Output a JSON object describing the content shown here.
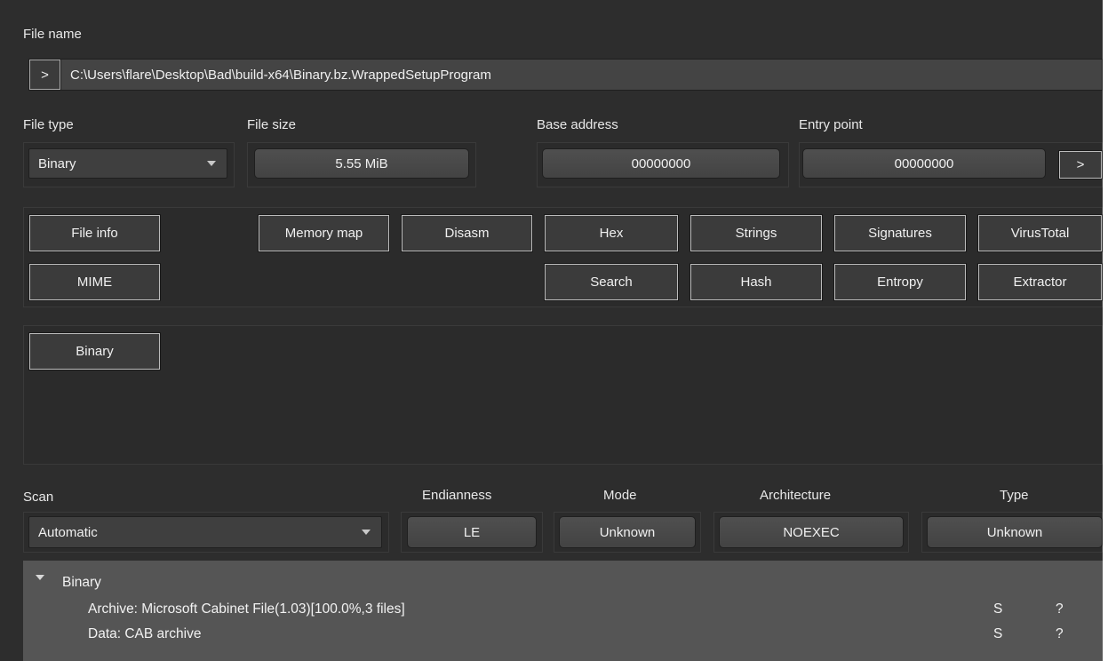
{
  "file_name": {
    "label": "File name",
    "open_button": ">",
    "path": "C:\\Users\\flare\\Desktop\\Bad\\build-x64\\Binary.bz.WrappedSetupProgram"
  },
  "info": {
    "file_type_label": "File type",
    "file_type_value": "Binary",
    "file_size_label": "File size",
    "file_size_value": "5.55 MiB",
    "base_address_label": "Base address",
    "base_address_value": "00000000",
    "entry_point_label": "Entry point",
    "entry_point_value": "00000000",
    "entry_point_button": ">"
  },
  "tools": {
    "file_info": "File info",
    "mime": "MIME",
    "memory_map": "Memory map",
    "disasm": "Disasm",
    "hex": "Hex",
    "strings": "Strings",
    "signatures": "Signatures",
    "virustotal": "VirusTotal",
    "search": "Search",
    "hash": "Hash",
    "entropy": "Entropy",
    "extractor": "Extractor"
  },
  "type_tabs": [
    "Binary"
  ],
  "scan": {
    "label": "Scan",
    "mode_value": "Automatic",
    "endianness_label": "Endianness",
    "endianness_value": "LE",
    "mode_label": "Mode",
    "mode_value2": "Unknown",
    "architecture_label": "Architecture",
    "architecture_value": "NOEXEC",
    "type_label": "Type",
    "type_value": "Unknown"
  },
  "results": {
    "root": "Binary",
    "rows": [
      {
        "text": "Archive: Microsoft Cabinet File(1.03)[100.0%,3 files]",
        "col1": "S",
        "col2": "?"
      },
      {
        "text": "Data: CAB archive",
        "col1": "S",
        "col2": "?"
      }
    ]
  },
  "colors": {
    "background": "#2d2d2d",
    "results_background": "#555555",
    "button_face": "#3b3b3b"
  }
}
